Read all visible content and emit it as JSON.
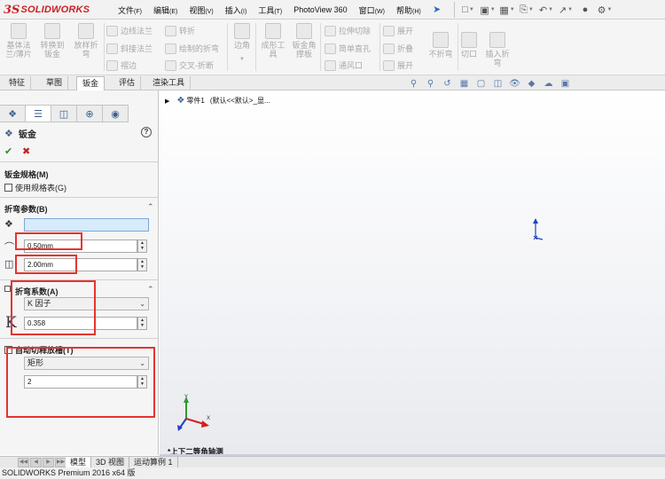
{
  "app": {
    "logo_mark": "3S",
    "logo_text": "SOLIDWORKS",
    "brand_color": "#cc1f26"
  },
  "menu": [
    {
      "label": "文件",
      "accel": "(F)"
    },
    {
      "label": "编辑",
      "accel": "(E)"
    },
    {
      "label": "视图",
      "accel": "(V)"
    },
    {
      "label": "插入",
      "accel": "(I)"
    },
    {
      "label": "工具",
      "accel": "(T)"
    },
    {
      "label": "PhotoView 360",
      "accel": ""
    },
    {
      "label": "窗口",
      "accel": "(W)"
    },
    {
      "label": "帮助",
      "accel": "(H)"
    }
  ],
  "ribbon": {
    "base_flange": "基体法兰/薄片",
    "convert_to_sheet_metal": "转换到钣金",
    "lofted_bend": "放样折弯",
    "edge_flange": "边线法兰",
    "miter_flange": "斜接法兰",
    "hem": "褶边",
    "jog": "转折",
    "sketched_bend": "绘制的折弯",
    "cross_break": "交叉-折断",
    "corners": "边角",
    "forming_tool": "成形工具",
    "sheet_metal_gusset": "钣金角撑板",
    "extruded_cut": "拉伸切除",
    "simple_hole": "简单直孔",
    "vent": "通风口",
    "unfold": "展开",
    "fold": "折叠",
    "flatten": "展开",
    "no_bends": "不折弯",
    "rip": "切口",
    "insert_bends": "插入折弯"
  },
  "command_tabs": [
    "特征",
    "草图",
    "钣金",
    "评估",
    "渲染工具"
  ],
  "tree": {
    "part_name": "零件1",
    "config": "(默认<<默认>_显..."
  },
  "property_manager": {
    "title": "钣金",
    "gauge_group": "钣金规格(M)",
    "use_gauge_table": "使用规格表(G)",
    "bend_params_group": "折弯参数(B)",
    "bend_radius": "0.50mm",
    "thickness": "2.00mm",
    "bend_allowance_group": "折弯系数(A)",
    "bend_allowance_type": "K 因子",
    "k_factor_symbol": "K",
    "k_factor": "0.358",
    "auto_relief_group": "自动切释放槽(T)",
    "relief_type": "矩形",
    "relief_ratio": "2"
  },
  "view": {
    "orientation_label": "*上下二等角轴测"
  },
  "bottom_tabs": [
    "模型",
    "3D 视图",
    "运动算例 1"
  ],
  "status_text": "SOLIDWORKS Premium 2016 x64 版",
  "annotation_color": "#e43430"
}
